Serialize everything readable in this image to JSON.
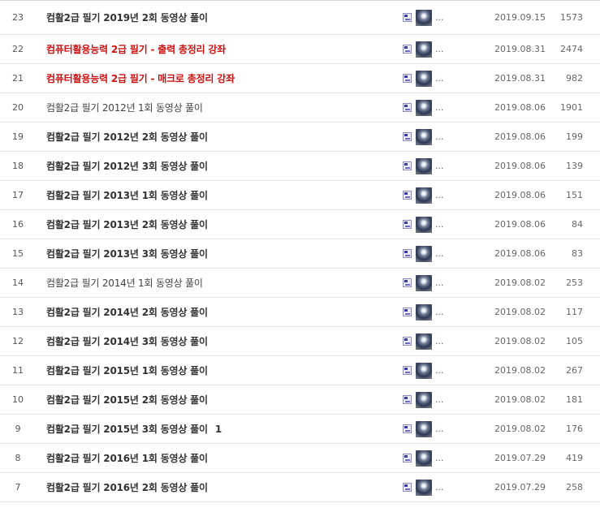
{
  "posts": [
    {
      "num": "23",
      "title": "컴활2급 필기 2019년 2회 동영상 풀이",
      "style": "bold",
      "comments": "",
      "ellipsis": "...",
      "date": "2019.09.15",
      "views": "1573"
    },
    {
      "num": "22",
      "title": "컴퓨터활용능력 2급 필기 - 출력 총정리 강좌",
      "style": "red",
      "comments": "",
      "ellipsis": "...",
      "date": "2019.08.31",
      "views": "2474"
    },
    {
      "num": "21",
      "title": "컴퓨터활용능력 2급 필기 - 매크로 총정리 강좌",
      "style": "red",
      "comments": "",
      "ellipsis": "...",
      "date": "2019.08.31",
      "views": "982"
    },
    {
      "num": "20",
      "title": "컴활2급 필기 2012년 1회 동영상 풀이",
      "style": "light",
      "comments": "",
      "ellipsis": "...",
      "date": "2019.08.06",
      "views": "1901"
    },
    {
      "num": "19",
      "title": "컴활2급 필기 2012년 2회 동영상 풀이",
      "style": "bold",
      "comments": "",
      "ellipsis": "...",
      "date": "2019.08.06",
      "views": "199"
    },
    {
      "num": "18",
      "title": "컴활2급 필기 2012년 3회 동영상 풀이",
      "style": "bold",
      "comments": "",
      "ellipsis": "...",
      "date": "2019.08.06",
      "views": "139"
    },
    {
      "num": "17",
      "title": "컴활2급 필기 2013년 1회 동영상 풀이",
      "style": "bold",
      "comments": "",
      "ellipsis": "...",
      "date": "2019.08.06",
      "views": "151"
    },
    {
      "num": "16",
      "title": "컴활2급 필기 2013년 2회 동영상 풀이",
      "style": "bold",
      "comments": "",
      "ellipsis": "...",
      "date": "2019.08.06",
      "views": "84"
    },
    {
      "num": "15",
      "title": "컴활2급 필기 2013년 3회 동영상 풀이",
      "style": "bold",
      "comments": "",
      "ellipsis": "...",
      "date": "2019.08.06",
      "views": "83"
    },
    {
      "num": "14",
      "title": "컴활2급 필기 2014년 1회 동영상 풀이",
      "style": "light",
      "comments": "",
      "ellipsis": "...",
      "date": "2019.08.02",
      "views": "253"
    },
    {
      "num": "13",
      "title": "컴활2급 필기 2014년 2회 동영상 풀이",
      "style": "bold",
      "comments": "",
      "ellipsis": "...",
      "date": "2019.08.02",
      "views": "117"
    },
    {
      "num": "12",
      "title": "컴활2급 필기 2014년 3회 동영상 풀이",
      "style": "bold",
      "comments": "",
      "ellipsis": "...",
      "date": "2019.08.02",
      "views": "105"
    },
    {
      "num": "11",
      "title": "컴활2급 필기 2015년 1회 동영상 풀이",
      "style": "bold",
      "comments": "",
      "ellipsis": "...",
      "date": "2019.08.02",
      "views": "267"
    },
    {
      "num": "10",
      "title": "컴활2급 필기 2015년 2회 동영상 풀이",
      "style": "bold",
      "comments": "",
      "ellipsis": "...",
      "date": "2019.08.02",
      "views": "181"
    },
    {
      "num": "9",
      "title": "컴활2급 필기 2015년 3회 동영상 풀이",
      "style": "bold",
      "comments": "1",
      "ellipsis": "...",
      "date": "2019.08.02",
      "views": "176"
    },
    {
      "num": "8",
      "title": "컴활2급 필기 2016년 1회 동영상 풀이",
      "style": "bold",
      "comments": "",
      "ellipsis": "...",
      "date": "2019.07.29",
      "views": "419"
    },
    {
      "num": "7",
      "title": "컴활2급 필기 2016년 2회 동영상 풀이",
      "style": "bold",
      "comments": "",
      "ellipsis": "...",
      "date": "2019.07.29",
      "views": "258"
    }
  ],
  "colors": {
    "highlight_title": "#cc1111",
    "text": "#333333",
    "meta": "#666666",
    "row_border": "#e5e5e5"
  },
  "icons": {
    "level": "member-level-icon",
    "avatar": "member-avatar-icon"
  }
}
